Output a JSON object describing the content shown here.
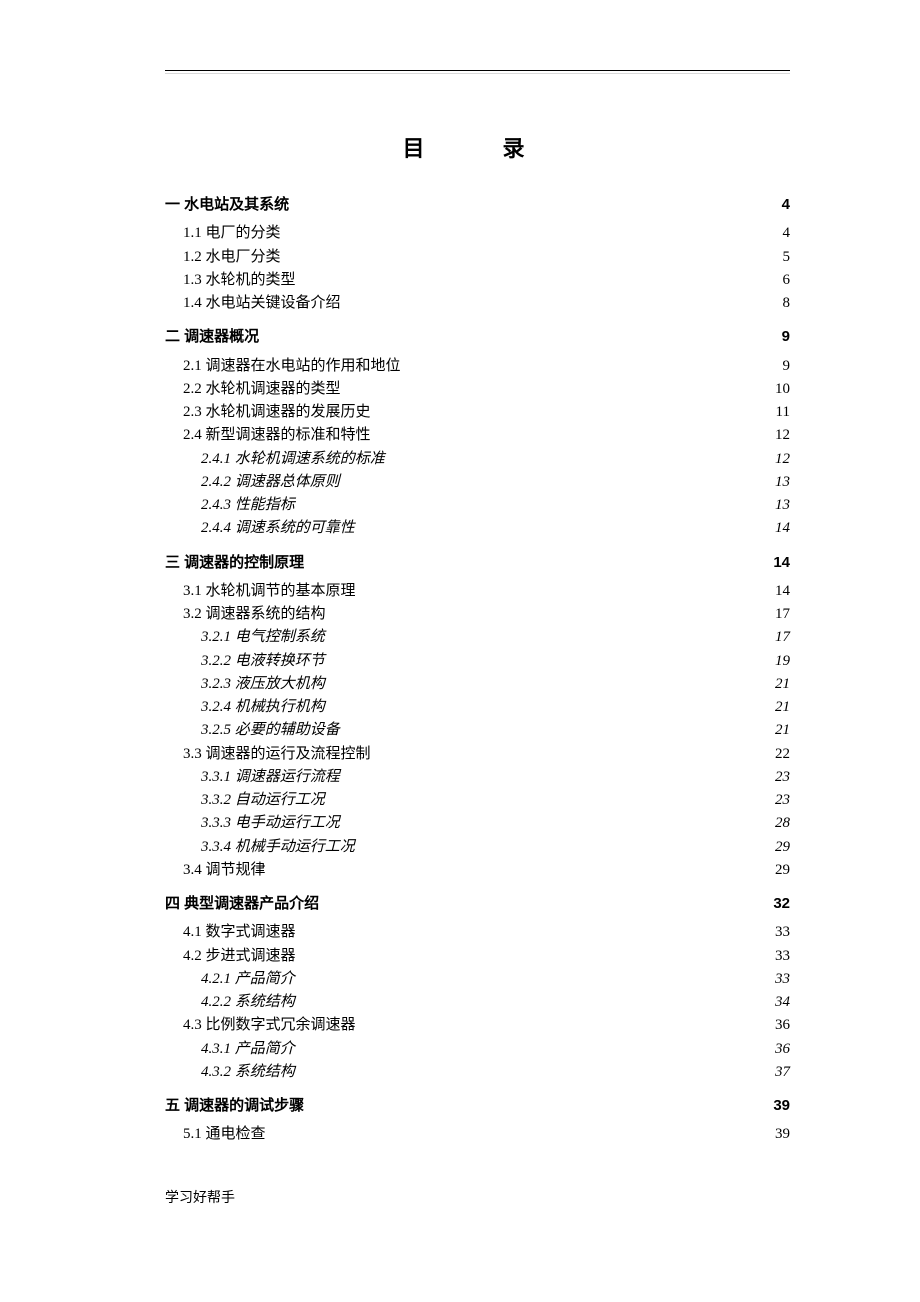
{
  "title": "目　录",
  "footer": "学习好帮手",
  "toc": [
    {
      "level": 1,
      "label": "一  水电站及其系统",
      "page": "4"
    },
    {
      "level": 2,
      "label": "1.1 电厂的分类",
      "page": "4"
    },
    {
      "level": 2,
      "label": "1.2 水电厂分类",
      "page": "5"
    },
    {
      "level": 2,
      "label": "1.3 水轮机的类型",
      "page": "6"
    },
    {
      "level": 2,
      "label": "1.4 水电站关键设备介绍",
      "page": "8"
    },
    {
      "level": 1,
      "label": "二  调速器概况",
      "page": "9"
    },
    {
      "level": 2,
      "label": "2.1 调速器在水电站的作用和地位",
      "page": "9"
    },
    {
      "level": 2,
      "label": "2.2 水轮机调速器的类型",
      "page": "10"
    },
    {
      "level": 2,
      "label": "2.3 水轮机调速器的发展历史",
      "page": "11"
    },
    {
      "level": 2,
      "label": "2.4 新型调速器的标准和特性",
      "page": "12"
    },
    {
      "level": 3,
      "label": "2.4.1 水轮机调速系统的标准",
      "page": "12"
    },
    {
      "level": 3,
      "label": "2.4.2 调速器总体原则",
      "page": "13"
    },
    {
      "level": 3,
      "label": "2.4.3 性能指标",
      "page": "13"
    },
    {
      "level": 3,
      "label": "2.4.4 调速系统的可靠性",
      "page": "14"
    },
    {
      "level": 1,
      "label": "三  调速器的控制原理",
      "page": "14"
    },
    {
      "level": 2,
      "label": "3.1 水轮机调节的基本原理",
      "page": "14"
    },
    {
      "level": 2,
      "label": "3.2 调速器系统的结构",
      "page": "17"
    },
    {
      "level": 3,
      "label": "3.2.1 电气控制系统",
      "page": "17"
    },
    {
      "level": 3,
      "label": "3.2.2 电液转换环节",
      "page": "19"
    },
    {
      "level": 3,
      "label": "3.2.3 液压放大机构",
      "page": "21"
    },
    {
      "level": 3,
      "label": "3.2.4 机械执行机构",
      "page": "21"
    },
    {
      "level": 3,
      "label": "3.2.5 必要的辅助设备",
      "page": "21"
    },
    {
      "level": 2,
      "label": "3.3 调速器的运行及流程控制",
      "page": "22"
    },
    {
      "level": 3,
      "label": "3.3.1 调速器运行流程",
      "page": "23"
    },
    {
      "level": 3,
      "label": "3.3.2 自动运行工况",
      "page": "23"
    },
    {
      "level": 3,
      "label": "3.3.3 电手动运行工况",
      "page": "28"
    },
    {
      "level": 3,
      "label": "3.3.4 机械手动运行工况",
      "page": "29"
    },
    {
      "level": 2,
      "label": "3.4 调节规律",
      "page": "29"
    },
    {
      "level": 1,
      "label": "四  典型调速器产品介绍",
      "page": "32"
    },
    {
      "level": 2,
      "label": "4.1 数字式调速器",
      "page": "33"
    },
    {
      "level": 2,
      "label": "4.2 步进式调速器",
      "page": "33"
    },
    {
      "level": 3,
      "label": "4.2.1 产品简介",
      "page": "33"
    },
    {
      "level": 3,
      "label": "4.2.2 系统结构",
      "page": "34"
    },
    {
      "level": 2,
      "label": "4.3 比例数字式冗余调速器",
      "page": "36"
    },
    {
      "level": 3,
      "label": "4.3.1 产品简介",
      "page": "36"
    },
    {
      "level": 3,
      "label": "4.3.2 系统结构",
      "page": "37"
    },
    {
      "level": 1,
      "label": "五  调速器的调试步骤",
      "page": "39"
    },
    {
      "level": 2,
      "label": "5.1 通电检查",
      "page": "39"
    }
  ]
}
